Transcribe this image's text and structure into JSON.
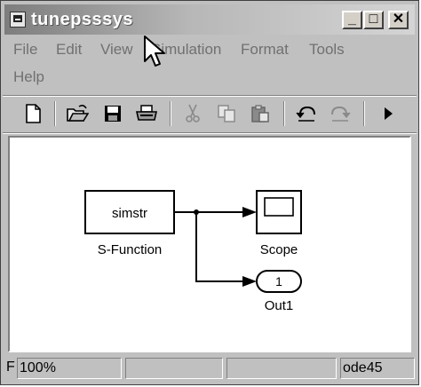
{
  "window": {
    "title": "tunepsssys"
  },
  "title_buttons": {
    "minimize": "_",
    "maximize": "□",
    "close": "✕"
  },
  "menus": [
    "File",
    "Edit",
    "View",
    "Simulation",
    "Format",
    "Tools",
    "Help"
  ],
  "toolbar": {
    "icons": [
      "new-icon",
      "open-icon",
      "save-icon",
      "print-icon",
      "cut-icon",
      "copy-icon",
      "paste-icon",
      "undo-icon",
      "redo-icon",
      "run-icon"
    ]
  },
  "diagram": {
    "sfunction_block": {
      "text": "simstr",
      "caption": "S-Function"
    },
    "scope_block": {
      "caption": "Scope"
    },
    "outport_block": {
      "number": "1",
      "caption": "Out1"
    }
  },
  "status": {
    "left_fragment": "F",
    "zoom": "100%",
    "solver": "ode45"
  }
}
